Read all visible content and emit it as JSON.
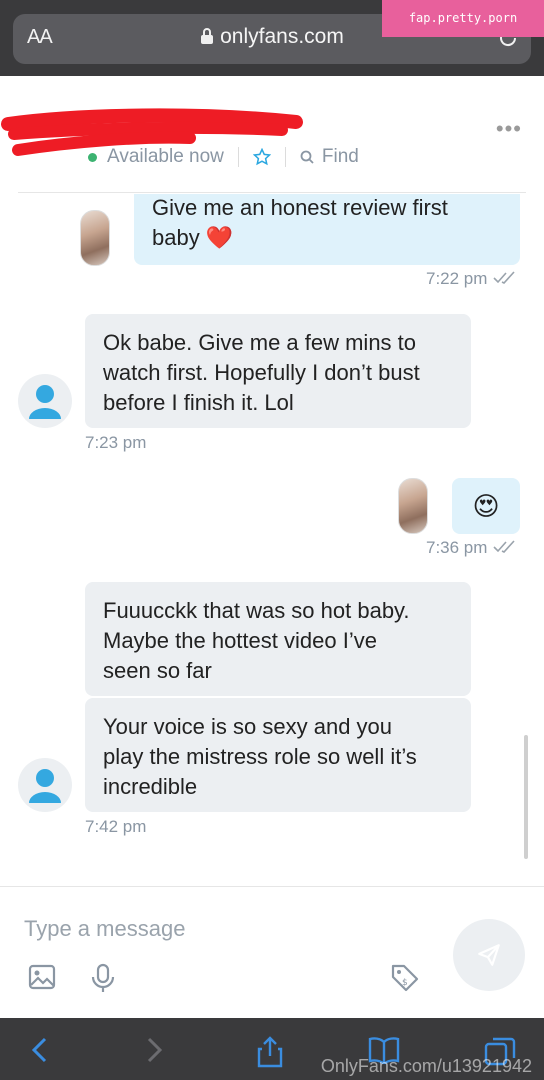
{
  "browser": {
    "text_size_label": "AA",
    "url": "onlyfans.com",
    "overlay_watermark": "fap.pretty.porn"
  },
  "chat": {
    "status": "Available now",
    "find_label": "Find",
    "more_label": "•••"
  },
  "messages": [
    {
      "direction": "out",
      "lines": [
        "Give me an honest review first",
        "baby ❤️"
      ],
      "time": "7:22 pm"
    },
    {
      "direction": "in",
      "lines": [
        "Ok babe. Give me a few mins to",
        "watch first. Hopefully I don’t bust",
        "before I finish it. Lol"
      ],
      "time": "7:23 pm"
    },
    {
      "direction": "out",
      "emoji": "😍",
      "time": "7:36 pm"
    },
    {
      "direction": "in",
      "lines": [
        "Fuuucckk that was so hot baby.",
        "Maybe the hottest video I’ve",
        "seen so far"
      ]
    },
    {
      "direction": "in",
      "lines": [
        "Your voice is so sexy and you",
        "play the mistress role so well it’s",
        "incredible"
      ],
      "time": "7:42 pm"
    }
  ],
  "composer": {
    "placeholder": "Type a message"
  },
  "footer": {
    "watermark": "OnlyFans.com/u13921942"
  }
}
